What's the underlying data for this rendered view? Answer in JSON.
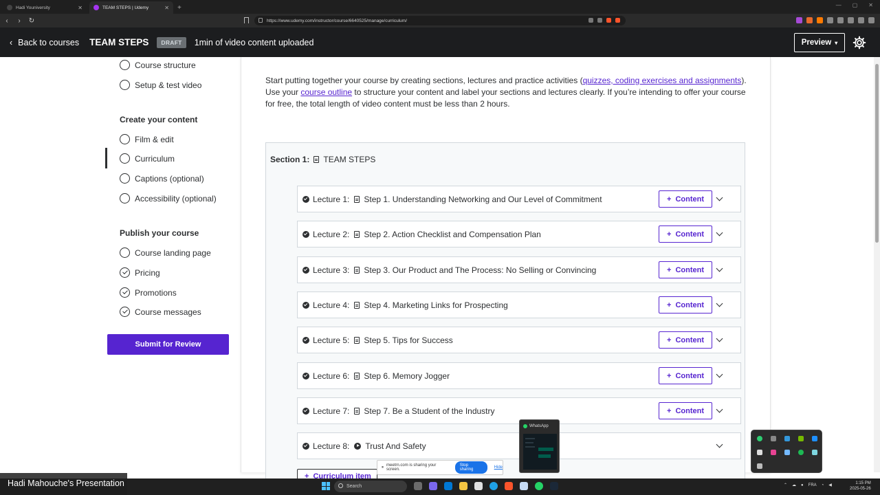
{
  "browser": {
    "tabs": [
      {
        "title": "Hadi Youniversity",
        "active": false
      },
      {
        "title": "TEAM STEPS | Udemy",
        "active": true
      }
    ],
    "url": "https://www.udemy.com/instructor/course/6640525/manage/curriculum/"
  },
  "header": {
    "back_label": "Back to courses",
    "course_title": "TEAM STEPS",
    "status_badge": "DRAFT",
    "upload_status": "1min of video content uploaded",
    "preview_label": "Preview"
  },
  "sidebar": {
    "plan_items": [
      {
        "label": "Course structure",
        "checked": false
      },
      {
        "label": "Setup & test video",
        "checked": false
      }
    ],
    "create_heading": "Create your content",
    "create_items": [
      {
        "label": "Film & edit",
        "checked": false
      },
      {
        "label": "Curriculum",
        "checked": false,
        "active": true
      },
      {
        "label": "Captions (optional)",
        "checked": false
      },
      {
        "label": "Accessibility (optional)",
        "checked": false
      }
    ],
    "publish_heading": "Publish your course",
    "publish_items": [
      {
        "label": "Course landing page",
        "checked": false
      },
      {
        "label": "Pricing",
        "checked": true
      },
      {
        "label": "Promotions",
        "checked": true
      },
      {
        "label": "Course messages",
        "checked": true
      }
    ],
    "submit_label": "Submit for Review"
  },
  "intro": {
    "t1": "Start putting together your course by creating sections, lectures and practice activities (",
    "link1": "quizzes, coding exercises and assignments",
    "t2": "). Use your ",
    "link2": "course outline",
    "t3": " to structure your content and label your sections and lectures clearly. If you’re intending to offer your course for free, the total length of video content must be less than 2 hours."
  },
  "section": {
    "label": "Section 1:",
    "title": "TEAM STEPS"
  },
  "lectures": [
    {
      "label": "Lecture 1:",
      "title": "Step 1. Understanding Networking and Our Level of Commitment",
      "content_btn": "Content",
      "type": "doc"
    },
    {
      "label": "Lecture 2:",
      "title": "Step 2. Action Checklist and Compensation Plan",
      "content_btn": "Content",
      "type": "doc"
    },
    {
      "label": "Lecture 3:",
      "title": "Step 3. Our Product and The Process: No Selling or Convincing",
      "content_btn": "Content",
      "type": "doc"
    },
    {
      "label": "Lecture 4:",
      "title": "Step 4. Marketing Links for Prospecting",
      "content_btn": "Content",
      "type": "doc"
    },
    {
      "label": "Lecture 5:",
      "title": "Step 5. Tips for Success",
      "content_btn": "Content",
      "type": "doc"
    },
    {
      "label": "Lecture 6:",
      "title": "Step 6. Memory Jogger",
      "content_btn": "Content",
      "type": "doc"
    },
    {
      "label": "Lecture 7:",
      "title": "Step 7. Be a Student of the Industry",
      "content_btn": "Content",
      "type": "doc"
    },
    {
      "label": "Lecture 8:",
      "title": "Trust And Safety",
      "content_btn": "",
      "type": "video"
    }
  ],
  "curriculum_item_label": "Curriculum item",
  "overlays": {
    "whatsapp_title": "WhatsApp",
    "share_text": "meetrn.com is sharing your screen.",
    "stop_label": "Stop sharing",
    "hide_label": "Hide",
    "presenter_name": "Hadi Mahouche's Presentation"
  },
  "taskbar": {
    "search_label": "Search",
    "lang": "FRA",
    "time": "1:15 PM",
    "date": "2025-05-26"
  },
  "colors": {
    "accent": "#5624d0",
    "header_bg": "#1c1d1f",
    "text": "#2d2f31"
  }
}
